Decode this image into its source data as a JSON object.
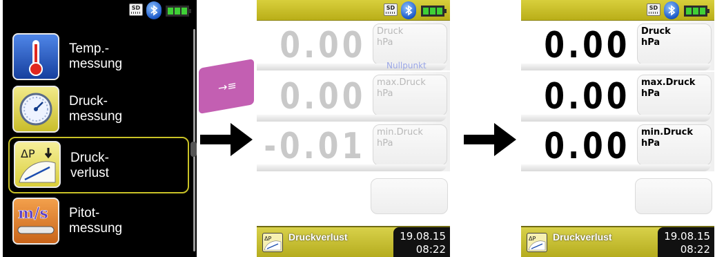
{
  "status": {
    "sd_label": "SD"
  },
  "menu": {
    "items": [
      {
        "line1": "Temp.-",
        "line2": "messung",
        "icon": "thermometer-icon"
      },
      {
        "line1": "Druck-",
        "line2": "messung",
        "icon": "pressure-gauge-icon"
      },
      {
        "line1": "Druck-",
        "line2": "verlust",
        "icon": "pressure-loss-icon",
        "icon_text": "ΔP",
        "selected": true
      },
      {
        "line1": "Pitot-",
        "line2": "messung",
        "icon": "pitot-tube-icon",
        "icon_text": "m/s"
      }
    ]
  },
  "key_button": {
    "icon": "arrow-to-list-icon"
  },
  "screen_before": {
    "rows": [
      {
        "value": "0.00",
        "label": "Druck",
        "unit": "hPa"
      },
      {
        "value": "0.00",
        "label": "max.Druck",
        "unit": "hPa"
      },
      {
        "value": "-0.01",
        "label": "min.Druck",
        "unit": "hPa"
      }
    ],
    "nullpunkt": "Nullpunkt"
  },
  "screen_after": {
    "rows": [
      {
        "value": "0.00",
        "label": "Druck",
        "unit": "hPa"
      },
      {
        "value": "0.00",
        "label": "max.Druck",
        "unit": "hPa"
      },
      {
        "value": "0.00",
        "label": "min.Druck",
        "unit": "hPa"
      }
    ]
  },
  "footer": {
    "program": "Druckverlust",
    "icon_text": "ΔP",
    "date": "19.08.15",
    "time": "08:22"
  },
  "colors": {
    "status_yellow": "#c9c027",
    "button_magenta": "#c35fb2",
    "battery_green": "#3fd036"
  }
}
